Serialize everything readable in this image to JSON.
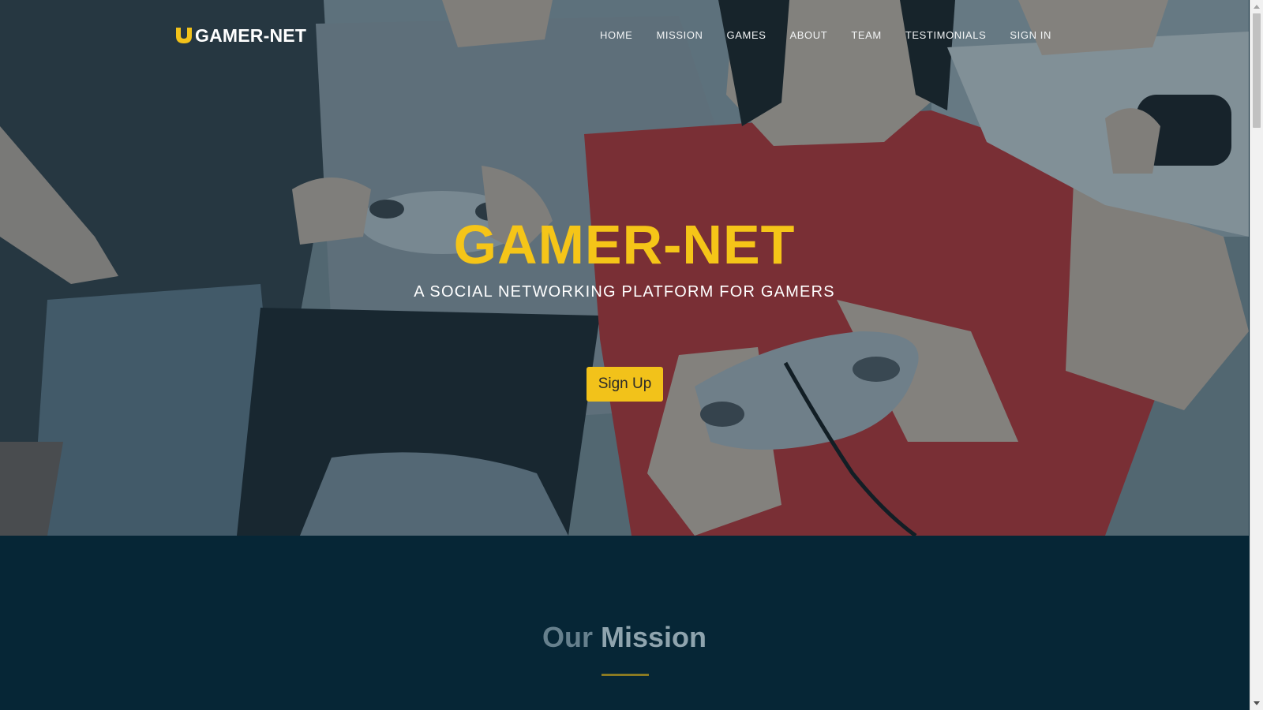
{
  "brand": {
    "name": "GAMER-NET",
    "icon": "horseshoe-u-logo-icon"
  },
  "nav": {
    "items": [
      "HOME",
      "MISSION",
      "GAMES",
      "ABOUT",
      "TEAM",
      "TESTIMONIALS",
      "SIGN IN"
    ]
  },
  "hero": {
    "title": "GAMER-NET",
    "subtitle": "A SOCIAL NETWORKING PLATFORM FOR GAMERS",
    "cta_label": "Sign Up"
  },
  "mission": {
    "heading_light": "Our",
    "heading_bold": "Mission"
  },
  "colors": {
    "accent_yellow": "#f2c21a",
    "dark_teal": "#062636",
    "red_shirt": "#b83030"
  }
}
